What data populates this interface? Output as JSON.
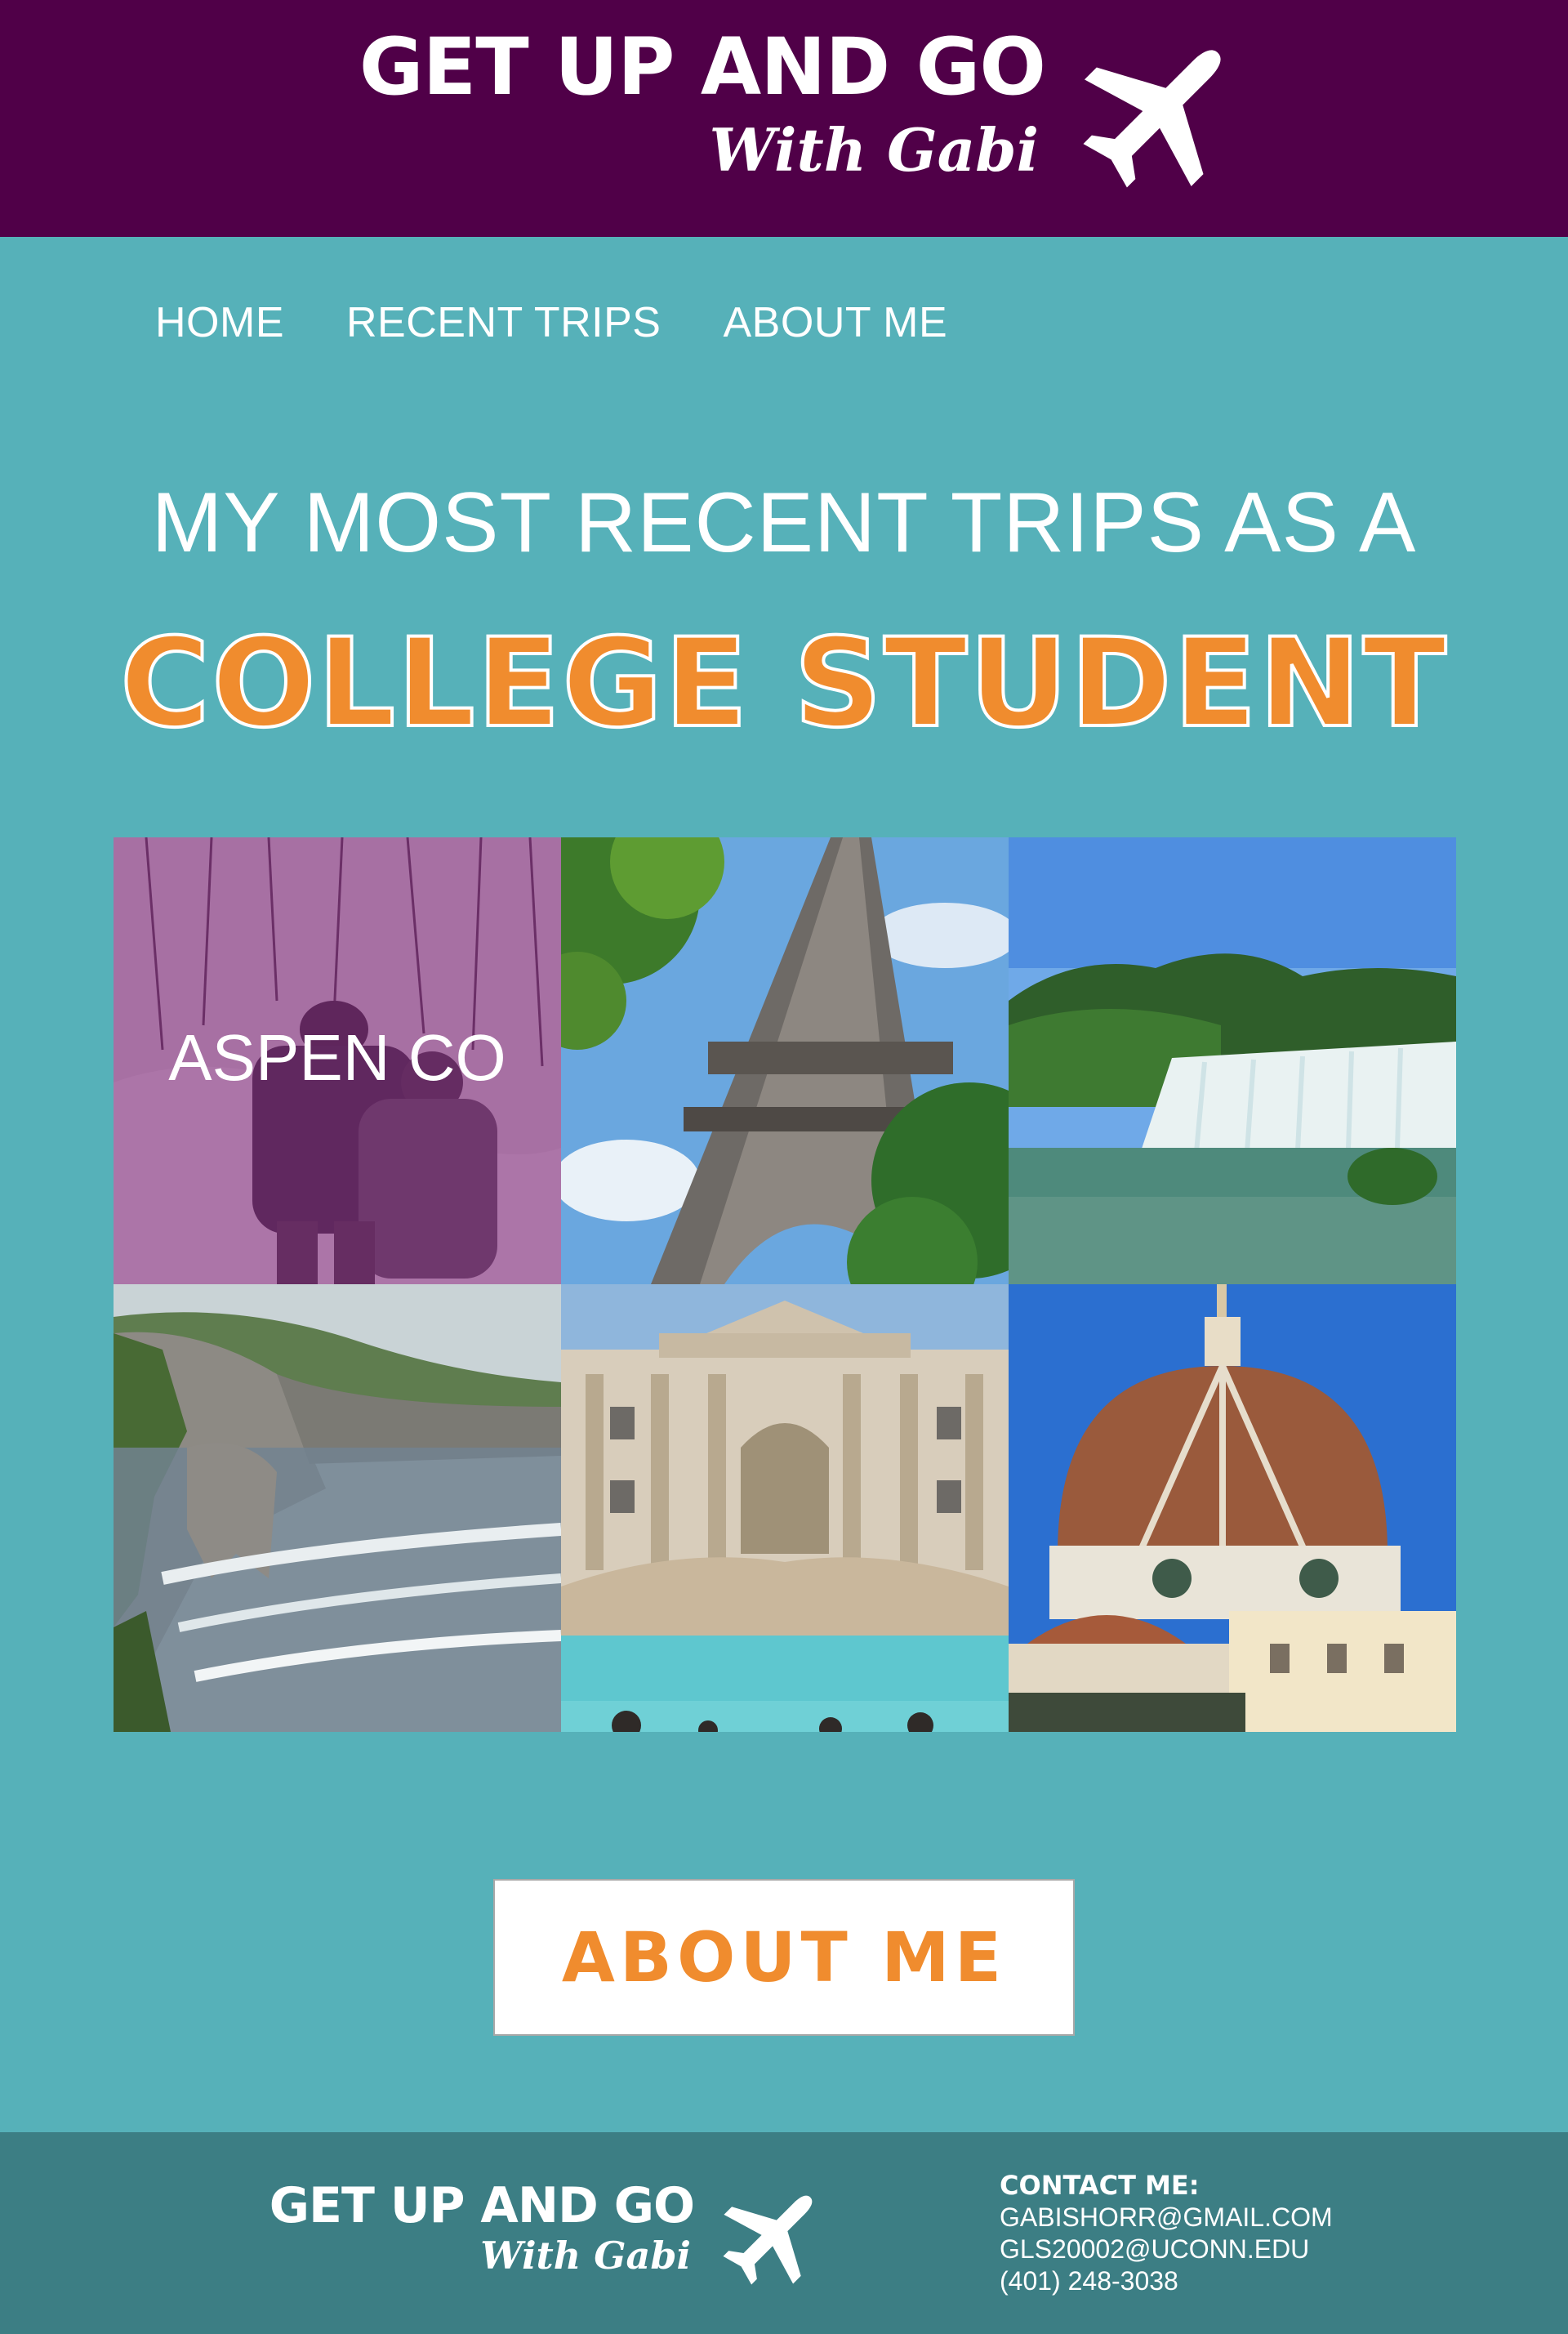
{
  "colors": {
    "header_bg": "#500048",
    "page_bg": "#56b1b9",
    "footer_bg": "#3c7e84",
    "accent": "#f08c2e",
    "text": "#ffffff"
  },
  "header": {
    "logo_title": "GET UP AND GO",
    "logo_subtitle": "With Gabi",
    "logo_icon": "airplane-icon"
  },
  "nav": {
    "items": [
      {
        "label": "HOME"
      },
      {
        "label": "RECENT TRIPS"
      },
      {
        "label": "ABOUT ME"
      }
    ]
  },
  "main": {
    "headline": "MY MOST RECENT TRIPS AS A",
    "headline_emphasis": "COLLEGE STUDENT",
    "gallery": {
      "tiles": [
        {
          "label": "ASPEN CO",
          "scene": "snowy-forest-hikers"
        },
        {
          "label": "",
          "scene": "eiffel-tower"
        },
        {
          "label": "",
          "scene": "waterfall-lake"
        },
        {
          "label": "",
          "scene": "sea-cliffs"
        },
        {
          "label": "",
          "scene": "trevi-fountain"
        },
        {
          "label": "",
          "scene": "florence-duomo"
        }
      ]
    },
    "about_button_label": "ABOUT ME"
  },
  "footer": {
    "logo_title": "GET UP AND GO",
    "logo_subtitle": "With Gabi",
    "contact_heading": "CONTACT ME:",
    "contact_lines": [
      "GABISHORR@GMAIL.COM",
      "GLS20002@UCONN.EDU",
      "(401) 248-3038"
    ]
  }
}
